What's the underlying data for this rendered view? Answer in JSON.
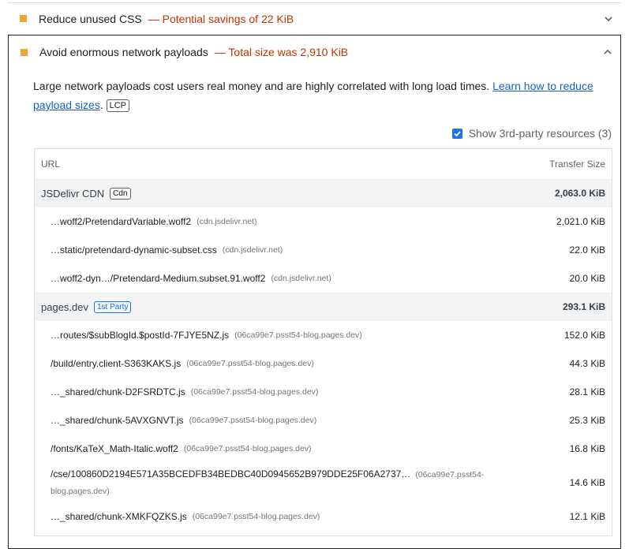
{
  "audit_unused_css": {
    "title": "Reduce unused CSS",
    "savings": "— Potential savings of 22 KiB",
    "indicator_color": "#f4a531"
  },
  "audit_payloads": {
    "title": "Avoid enormous network payloads",
    "summary": "— Total size was 2,910 KiB",
    "description": "Large network payloads cost users real money and are highly correlated with long load times.",
    "learn_link": "Learn how to reduce payload sizes",
    "metric_tag": "LCP",
    "third_party_label": "Show 3rd-party resources (3)",
    "third_party_checked": true,
    "table": {
      "col_url": "URL",
      "col_size": "Transfer Size",
      "groups": [
        {
          "name": "JSDelivr CDN",
          "tag": "Cdn",
          "size": "2,063.0 KiB",
          "rows": [
            {
              "url": "…woff2/PretendardVariable.woff2",
              "host": "(cdn.jsdelivr.net)",
              "size": "2,021.0 KiB"
            },
            {
              "url": "…static/pretendard-dynamic-subset.css",
              "host": "(cdn.jsdelivr.net)",
              "size": "22.0 KiB"
            },
            {
              "url": "…woff2-dyn…/Pretendard-Medium.subset.91.woff2",
              "host": "(cdn.jsdelivr.net)",
              "size": "20.0 KiB"
            }
          ]
        },
        {
          "name": "pages.dev",
          "tag": "1st Party",
          "size": "293.1 KiB",
          "rows": [
            {
              "url": "…routes/$subBlogId.$postId-7FJYE5NZ.js",
              "host": "(06ca99e7.psst54-blog.pages.dev)",
              "size": "152.0 KiB"
            },
            {
              "url": "/build/entry.client-S363KAKS.js",
              "host": "(06ca99e7.psst54-blog.pages.dev)",
              "size": "44.3 KiB"
            },
            {
              "url": "…_shared/chunk-D2FSRDTC.js",
              "host": "(06ca99e7.psst54-blog.pages.dev)",
              "size": "28.1 KiB"
            },
            {
              "url": "…_shared/chunk-5AVXGNVT.js",
              "host": "(06ca99e7.psst54-blog.pages.dev)",
              "size": "25.3 KiB"
            },
            {
              "url": "/fonts/KaTeX_Math-Italic.woff2",
              "host": "(06ca99e7.psst54-blog.pages.dev)",
              "size": "16.8 KiB"
            },
            {
              "url": "/cse/100860D2194E571A35BCEDFB34BEDBC40D0945652B979DDE25F06A2737…",
              "host": "(06ca99e7.psst54-blog.pages.dev)",
              "size": "14.6 KiB"
            },
            {
              "url": "…_shared/chunk-XMKFQZKS.js",
              "host": "(06ca99e7.psst54-blog.pages.dev)",
              "size": "12.1 KiB"
            }
          ]
        }
      ]
    }
  }
}
